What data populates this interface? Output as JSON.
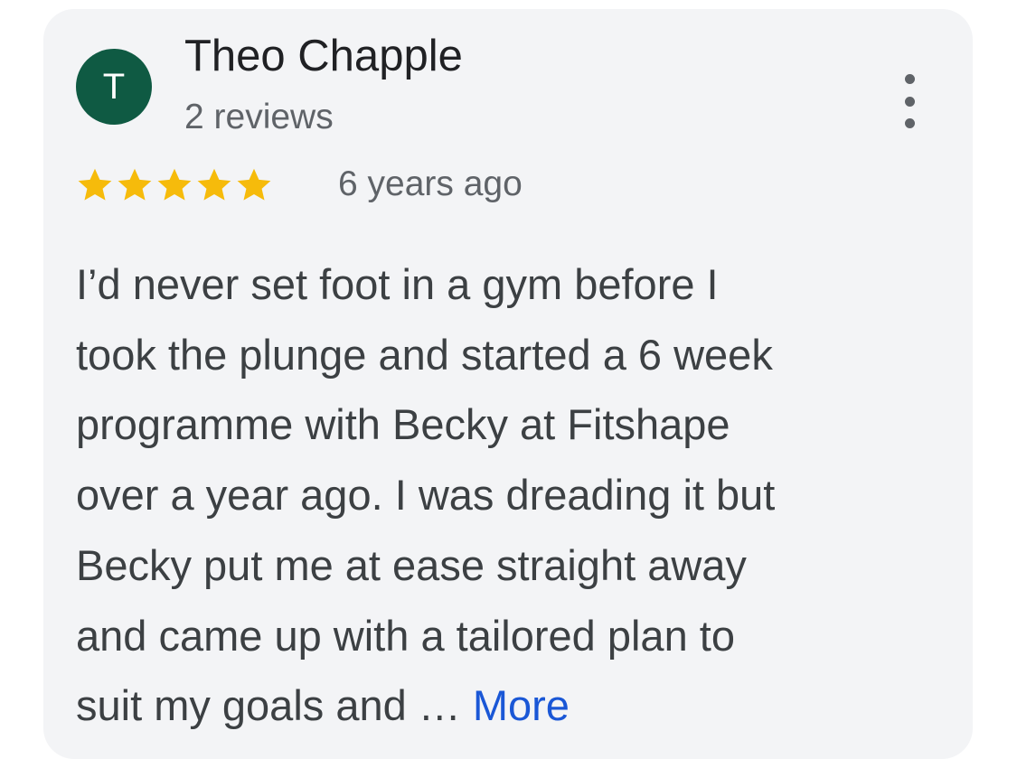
{
  "review": {
    "avatar_letter": "T",
    "avatar_color": "#0f5a43",
    "author_name": "Theo Chapple",
    "author_reviews": "2 reviews",
    "menu_icon": "more-vert-icon",
    "rating": 5,
    "rating_max": 5,
    "star_color": "#f6bb0b",
    "time_ago": "6 years ago",
    "text_lines": [
      "I’d never set foot in a gym before I",
      "took the plunge and started a 6 week",
      "programme with Becky at Fitshape",
      "over a year ago. I was dreading it but",
      "Becky put me at ease straight away",
      "and came up with a tailored plan to",
      "suit my goals and … "
    ],
    "more_label": "More",
    "more_color": "#1a57d6"
  }
}
